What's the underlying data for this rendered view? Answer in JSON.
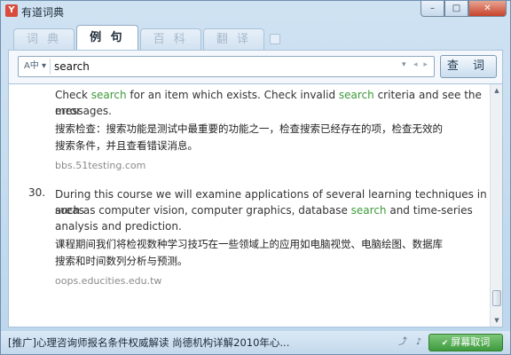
{
  "app": {
    "logo_letter": "Y",
    "title": "有道词典",
    "window_buttons": {
      "minimize": "–",
      "maximize": "□",
      "close": "✕"
    }
  },
  "tabs": [
    {
      "label": "词 典",
      "active": false
    },
    {
      "label": "例 句",
      "active": true
    },
    {
      "label": "百 科",
      "active": false
    },
    {
      "label": "翻 译",
      "active": false
    }
  ],
  "search": {
    "lang_label": "A中 ▾",
    "query": "search",
    "button_label": "查 词",
    "dropdown_glyph": "▾",
    "nav_glyphs": "◂ ▸"
  },
  "results": [
    {
      "number": "",
      "en_lines": [
        [
          "Check ",
          {
            "hl": "search"
          },
          " for an item which exists. Check invalid ",
          {
            "hl": "search"
          },
          " criteria and see the error"
        ],
        [
          "messages."
        ]
      ],
      "zh_lines": [
        "搜索检查：搜索功能是测试中最重要的功能之一，检查搜索已经存在的项，检查无效的",
        "搜索条件，并且查看错误消息。"
      ],
      "source": "bbs.51testing.com"
    },
    {
      "number": "30.",
      "en_lines": [
        [
          "During this course we will examine applications of several learning techniques in areas"
        ],
        [
          "such as computer vision, computer graphics, database ",
          {
            "hl": "search"
          },
          " and time-series"
        ],
        [
          "analysis and prediction."
        ]
      ],
      "zh_lines": [
        "课程期间我们将检视数种学习技巧在一些领域上的应用如电脑视觉、电脑绘图、数据库",
        "搜索和时间数列分析与预测。"
      ],
      "source": "oops.educities.edu.tw"
    }
  ],
  "statusbar": {
    "ad_text": "[推广]心理咨询师报名条件权威解读 尚德机构详解2010年心...",
    "screen_dict_label": "屏幕取词",
    "screen_dict_checked": true
  },
  "colors": {
    "highlight": "#3d9a3a",
    "title_bar": "#cfe2f2",
    "screen_dict_button": "#4ea84c"
  }
}
